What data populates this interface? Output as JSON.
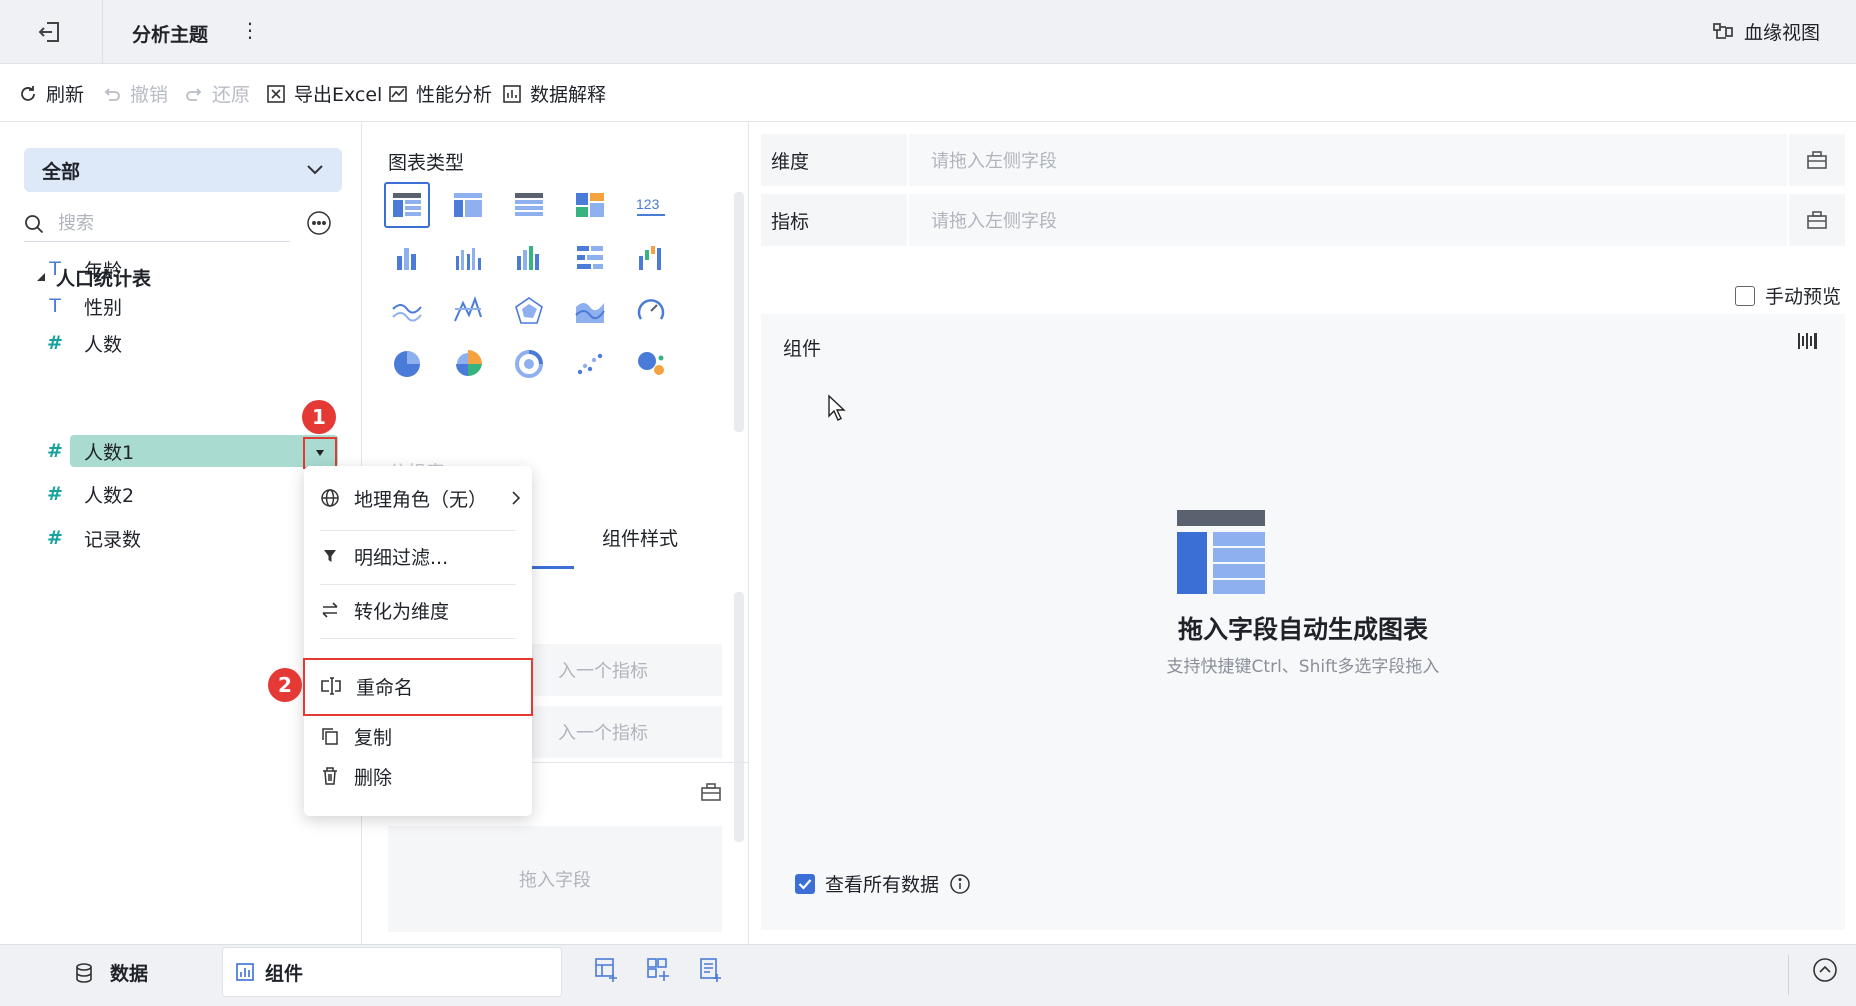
{
  "topbar": {
    "title": "分析主题",
    "more": "⋮",
    "lineage_label": "血缘视图"
  },
  "toolbar": {
    "refresh": "刷新",
    "undo": "撤销",
    "redo": "还原",
    "export_excel": "导出Excel",
    "performance": "性能分析",
    "data_explain": "数据解释"
  },
  "data_panel": {
    "scope": "全部",
    "search_placeholder": "搜索",
    "table_name": "人口统计表",
    "fields": [
      {
        "type": "T",
        "name": "年龄"
      },
      {
        "type": "T",
        "name": "性别"
      },
      {
        "type": "#",
        "name": "人数"
      },
      {
        "type": "#",
        "name": "人数1"
      },
      {
        "type": "#",
        "name": "人数2"
      },
      {
        "type": "#",
        "name": "记录数"
      }
    ],
    "markers": [
      "1",
      "2"
    ]
  },
  "component_panel": {
    "chart_type_label": "图表类型",
    "tab_style": "组件样式",
    "ghost_label": "分组表",
    "metric_placeholder_1": "入一个指标",
    "metric_placeholder_2": "入一个指标",
    "drag_field": "拖入字段",
    "chart_types": [
      "group-table-icon",
      "cross-table-icon",
      "detail-table-icon",
      "kpi-card-icon",
      "number-123-icon",
      "stacked-bar-icon",
      "multi-bar-icon",
      "grouped-column-icon",
      "horizontal-bar-icon",
      "waterfall-icon",
      "area-line-icon",
      "line-chart-icon",
      "radar-icon",
      "area-chart-icon",
      "gauge-icon",
      "pie-chart-icon",
      "rose-pie-icon",
      "ring-chart-icon",
      "scatter-icon",
      "bubble-icon"
    ],
    "number_glyph": "123"
  },
  "context_menu": {
    "geo_role": "地理角色（无）",
    "detail_filter": "明细过滤...",
    "convert_dimension": "转化为维度",
    "rename": "重命名",
    "copy": "复制",
    "delete": "删除"
  },
  "canvas": {
    "dimension_label": "维度",
    "dimension_placeholder": "请拖入左侧字段",
    "metric_label": "指标",
    "metric_placeholder": "请拖入左侧字段",
    "manual_preview": "手动预览",
    "component_label": "组件",
    "empty_title": "拖入字段自动生成图表",
    "empty_subtitle": "支持快捷键Ctrl、Shift多选字段拖入",
    "view_all_data": "查看所有数据",
    "view_all_checked": true
  },
  "bottombar": {
    "data_tab": "数据",
    "component_tab": "组件"
  },
  "colors": {
    "accent": "#3b6fd6",
    "highlight": "#a9dbd0",
    "marker": "#e53935",
    "field_number": "#17a2a0"
  }
}
